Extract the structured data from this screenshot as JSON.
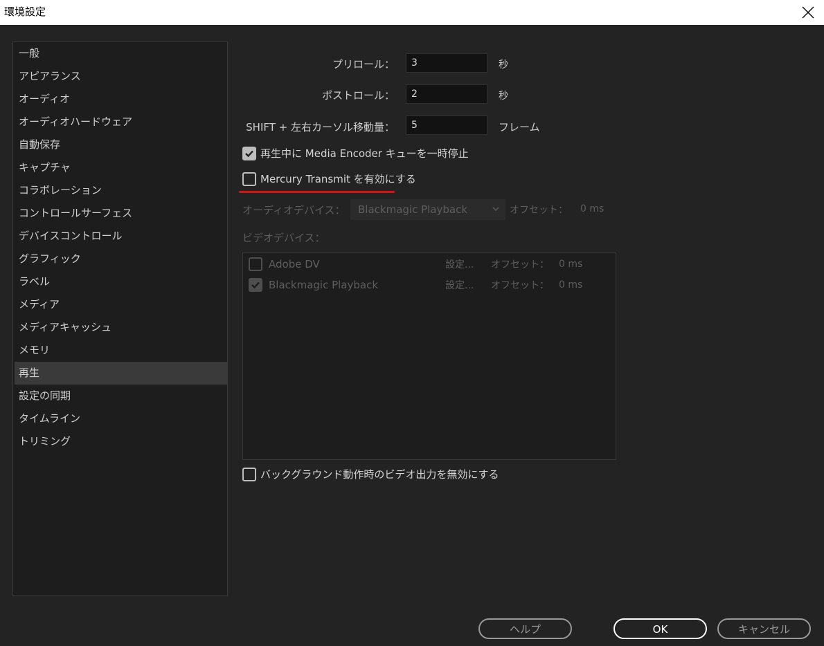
{
  "window": {
    "title": "環境設定"
  },
  "sidebar": {
    "items": [
      {
        "label": "一般"
      },
      {
        "label": "アピアランス"
      },
      {
        "label": "オーディオ"
      },
      {
        "label": "オーディオハードウェア"
      },
      {
        "label": "自動保存"
      },
      {
        "label": "キャプチャ"
      },
      {
        "label": "コラボレーション"
      },
      {
        "label": "コントロールサーフェス"
      },
      {
        "label": "デバイスコントロール"
      },
      {
        "label": "グラフィック"
      },
      {
        "label": "ラベル"
      },
      {
        "label": "メディア"
      },
      {
        "label": "メディアキャッシュ"
      },
      {
        "label": "メモリ"
      },
      {
        "label": "再生",
        "active": true
      },
      {
        "label": "設定の同期"
      },
      {
        "label": "タイムライン"
      },
      {
        "label": "トリミング"
      }
    ]
  },
  "playback": {
    "preroll": {
      "label": "プリロール：",
      "value": "3",
      "unit": "秒"
    },
    "postroll": {
      "label": "ポストロール：",
      "value": "2",
      "unit": "秒"
    },
    "shift": {
      "label": "SHIFT + 左右カーソル移動量：",
      "value": "5",
      "unit": "フレーム"
    },
    "pause_encoder": {
      "label": "再生中に Media Encoder キューを一時停止",
      "checked": true
    },
    "mercury": {
      "label": "Mercury Transmit を有効にする",
      "checked": false
    },
    "audio_device": {
      "label": "オーディオデバイス：",
      "selected": "Blackmagic Playback",
      "offset_label": "オフセット：",
      "offset_value": "0 ms"
    },
    "video_device": {
      "label": "ビデオデバイス："
    },
    "video_devices": [
      {
        "name": "Adobe DV",
        "checked": false,
        "settings": "設定...",
        "offset_label": "オフセット：",
        "offset_value": "0 ms"
      },
      {
        "name": "Blackmagic Playback",
        "checked": true,
        "settings": "設定...",
        "offset_label": "オフセット：",
        "offset_value": "0 ms"
      }
    ],
    "background": {
      "label": "バックグラウンド動作時のビデオ出力を無効にする",
      "checked": false
    }
  },
  "buttons": {
    "help": "ヘルプ",
    "ok": "OK",
    "cancel": "キャンセル"
  },
  "colors": {
    "highlight_underline": "#d31515",
    "background": "#232323"
  }
}
